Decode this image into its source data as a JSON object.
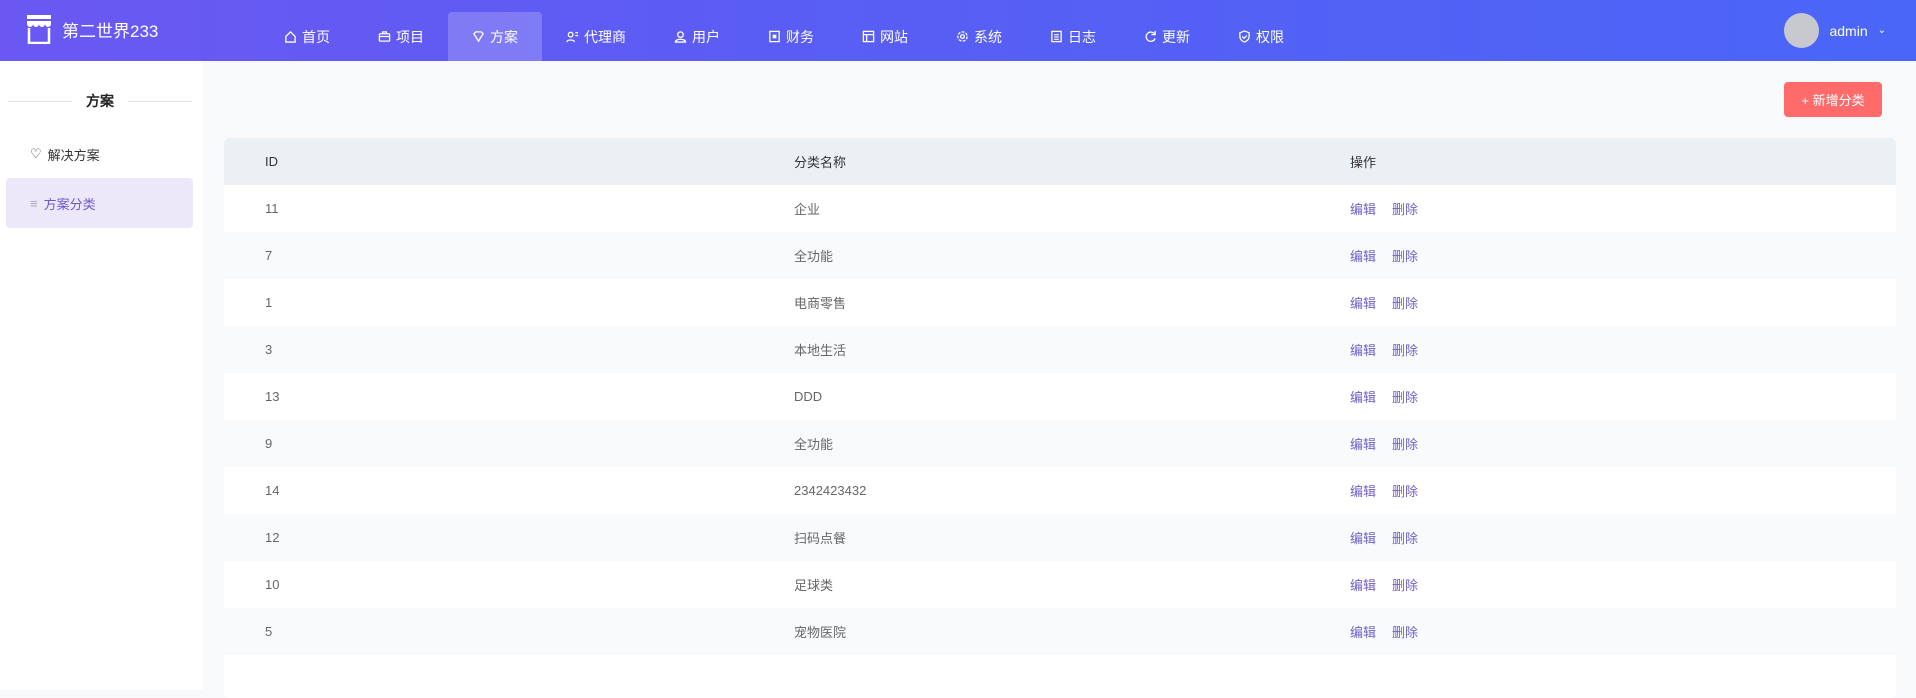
{
  "header": {
    "brand": "第二世界233",
    "user": "admin",
    "nav": [
      {
        "label": "首页",
        "icon": "home-icon"
      },
      {
        "label": "项目",
        "icon": "briefcase-icon"
      },
      {
        "label": "方案",
        "icon": "diamond-icon",
        "active": true
      },
      {
        "label": "代理商",
        "icon": "agent-icon"
      },
      {
        "label": "用户",
        "icon": "user-icon"
      },
      {
        "label": "财务",
        "icon": "finance-icon"
      },
      {
        "label": "网站",
        "icon": "layout-icon"
      },
      {
        "label": "系统",
        "icon": "gear-icon"
      },
      {
        "label": "日志",
        "icon": "log-icon"
      },
      {
        "label": "更新",
        "icon": "refresh-icon"
      },
      {
        "label": "权限",
        "icon": "shield-icon"
      }
    ]
  },
  "sidebar": {
    "title": "方案",
    "items": [
      {
        "label": "解决方案"
      },
      {
        "label": "方案分类"
      }
    ]
  },
  "toolbar": {
    "add_label": "+ 新增分类"
  },
  "table": {
    "headers": [
      "ID",
      "分类名称",
      "操作"
    ],
    "edit": "编辑",
    "delete": "删除",
    "rows": [
      {
        "id": "11",
        "name": "企业"
      },
      {
        "id": "7",
        "name": "全功能"
      },
      {
        "id": "1",
        "name": "电商零售"
      },
      {
        "id": "3",
        "name": "本地生活"
      },
      {
        "id": "13",
        "name": "DDD"
      },
      {
        "id": "9",
        "name": "全功能"
      },
      {
        "id": "14",
        "name": "2342423432"
      },
      {
        "id": "12",
        "name": "扫码点餐"
      },
      {
        "id": "10",
        "name": "足球类"
      },
      {
        "id": "5",
        "name": "宠物医院"
      }
    ]
  }
}
